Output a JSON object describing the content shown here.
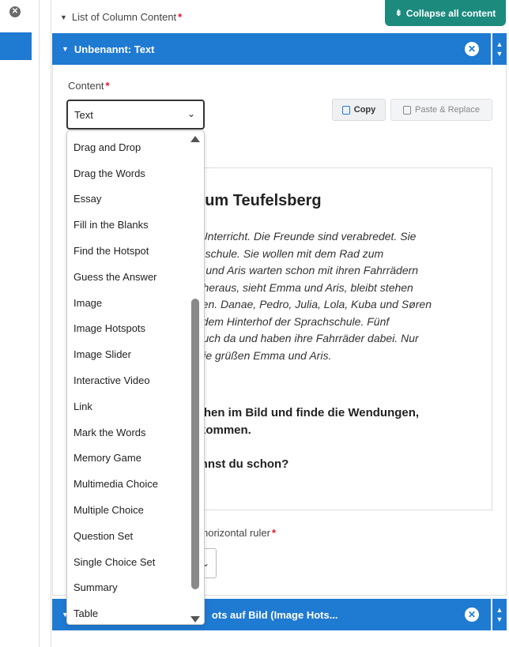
{
  "list_header": {
    "label": "List of Column Content",
    "required_mark": "*"
  },
  "collapse_button": {
    "label": "Collapse all content"
  },
  "section_top": {
    "title": "Unbenannt: Text"
  },
  "section_bottom": {
    "title": "ots auf Bild (Image Hots..."
  },
  "content_field": {
    "label": "Content",
    "required_mark": "*",
    "selected": "Text"
  },
  "buttons": {
    "copy": "Copy",
    "paste": "Paste & Replace"
  },
  "dropdown": {
    "options": [
      "Drag and Drop",
      "Drag the Words",
      "Essay",
      "Fill in the Blanks",
      "Find the Hotspot",
      "Guess the Answer",
      "Image",
      "Image Hotspots",
      "Image Slider",
      "Interactive Video",
      "Link",
      "Mark the Words",
      "Memory Game",
      "Multimedia Choice",
      "Multiple Choice",
      "Question Set",
      "Single Choice Set",
      "Summary",
      "Table",
      "Text"
    ],
    "selected_index": 19
  },
  "preview": {
    "title": "; zum Teufelsberg",
    "paragraph_lines": [
      "m Unterricht. Die Freunde sind verabredet. Sie",
      "achschule. Sie wollen mit dem Rad zum",
      "ma und Aris warten schon mit ihren Fahrrädern",
      "mt heraus, sieht Emma und Aris, bleibt stehen",
      "ihnen. Danae, Pedro, Julia, Lola, Kuba und Søren",
      "us dem Hinterhof der Sprachschule. Fünf",
      "e auch da und haben ihre Fahrräder dabei. Nur",
      "l. Sie grüßen Emma und Aris."
    ],
    "question1_lines": [
      "eichen im Bild und finde die Wendungen,",
      "orkommen."
    ],
    "question2": " kennst du schon?"
  },
  "hr_field": {
    "label": "horizontal ruler",
    "required_mark": "*"
  }
}
